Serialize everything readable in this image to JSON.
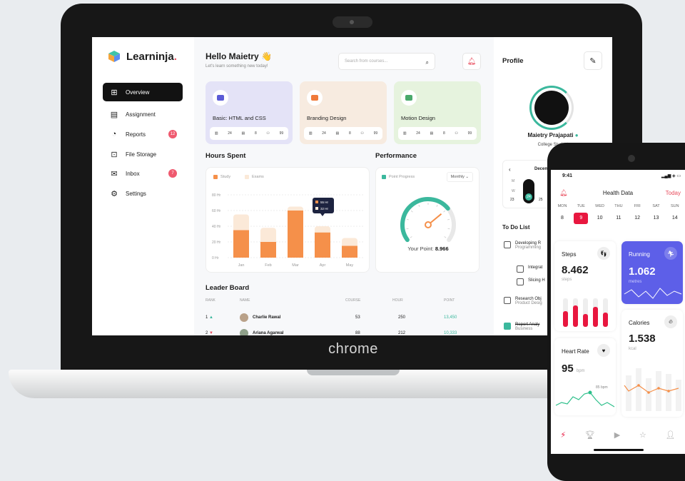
{
  "device": {
    "brand": "chrome"
  },
  "app": {
    "logo": "Learninja",
    "logo_dot": "."
  },
  "sidebar": {
    "items": [
      {
        "label": "Overview",
        "icon": "grid-icon",
        "active": true
      },
      {
        "label": "Assignment",
        "icon": "clipboard-icon"
      },
      {
        "label": "Reports",
        "icon": "pie-icon",
        "badge": "12"
      },
      {
        "label": "File Storage",
        "icon": "file-icon"
      },
      {
        "label": "Inbox",
        "icon": "inbox-icon",
        "badge": "7"
      },
      {
        "label": "Settings",
        "icon": "gear-icon"
      }
    ]
  },
  "header": {
    "greeting": "Hello Maietry 👋",
    "subtitle": "Let's learn something new today!",
    "search_placeholder": "Search from courses..."
  },
  "courses": [
    {
      "name": "Basic: HTML and CSS",
      "color": "#e4e3f7",
      "icon_color": "#5b5bd6",
      "lessons": "24",
      "assign": "8",
      "students": "99"
    },
    {
      "name": "Branding Design",
      "color": "#f7ebe0",
      "icon_color": "#f07a3a",
      "lessons": "24",
      "assign": "8",
      "students": "99"
    },
    {
      "name": "Motion Design",
      "color": "#e6f3de",
      "icon_color": "#4aa96c",
      "lessons": "24",
      "assign": "8",
      "students": "99"
    }
  ],
  "hours": {
    "title": "Hours Spent",
    "legend": [
      "Study",
      "Exams"
    ],
    "tooltip": [
      "55 Hr",
      "32 Hr"
    ]
  },
  "chart_data": {
    "type": "bar",
    "categories": [
      "Jan",
      "Feb",
      "Mar",
      "Apr",
      "May"
    ],
    "series": [
      {
        "name": "Study",
        "values": [
          35,
          20,
          60,
          32,
          15
        ]
      },
      {
        "name": "Exams",
        "values": [
          20,
          18,
          5,
          8,
          10
        ]
      }
    ],
    "yticks": [
      "80 Hr",
      "60 Hr",
      "40 Hr",
      "20 Hr",
      "0 Hr"
    ],
    "ylim": [
      0,
      80
    ]
  },
  "performance": {
    "title": "Performance",
    "legend": "Point Progress",
    "period": "Monthly",
    "score_label": "Your Point:",
    "score": "8.966",
    "gauge": 0.7
  },
  "leaderboard": {
    "title": "Leader Board",
    "headers": [
      "RANK",
      "NAME",
      "COURSE",
      "HOUR",
      "POINT"
    ],
    "rows": [
      {
        "rank": "1",
        "trend": "▲",
        "name": "Charlie Rawal",
        "course": "53",
        "hour": "250",
        "point": "13,450"
      },
      {
        "rank": "2",
        "trend": "▼",
        "name": "Ariana Agarwal",
        "course": "88",
        "hour": "212",
        "point": "10,333"
      }
    ]
  },
  "profile": {
    "title": "Profile",
    "name": "Maietry Prajapati",
    "role": "College Student",
    "calendar_month": "December",
    "cal_days": [
      "M",
      "W",
      "23",
      "24",
      "25"
    ]
  },
  "todo": {
    "title": "To Do List",
    "items": [
      {
        "title": "Developing R",
        "sub": "Programming",
        "done": false
      },
      {
        "title": "Integrat",
        "sub": "",
        "done": false
      },
      {
        "title": "Slicing H",
        "sub": "",
        "done": false
      },
      {
        "title": "Research Obj",
        "sub": "Product Desig",
        "done": false
      },
      {
        "title": "Report Analy",
        "sub": "Business",
        "done": true
      }
    ]
  },
  "phone": {
    "time": "9:41",
    "title": "Health Data",
    "today": "Today",
    "week": [
      "MON",
      "TUE",
      "WED",
      "THU",
      "FRI",
      "SAT",
      "SUN"
    ],
    "days": [
      "8",
      "9",
      "10",
      "11",
      "12",
      "13",
      "14"
    ],
    "selected_day": "9",
    "steps": {
      "label": "Steps",
      "value": "8.462",
      "unit": "steps"
    },
    "running": {
      "label": "Running",
      "value": "1.062",
      "unit": "metres"
    },
    "heart": {
      "label": "Heart Rate",
      "value": "95",
      "unit": "bpm",
      "marker": "85 bpm"
    },
    "calories": {
      "label": "Calories",
      "value": "1.538",
      "unit": "kcal"
    }
  }
}
